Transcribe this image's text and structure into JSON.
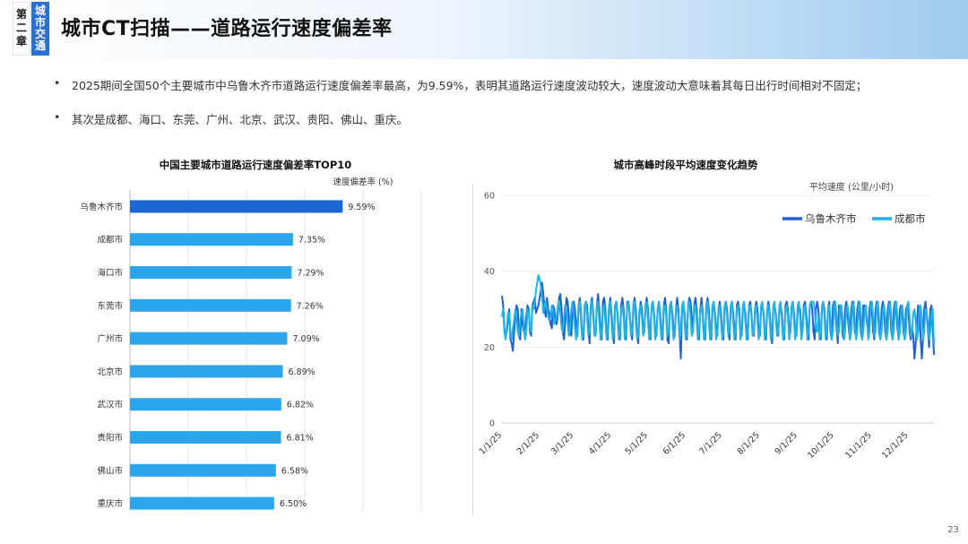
{
  "header": {
    "chapter_part1": "第二章",
    "chapter_part2": "城市交通",
    "title": "城市CT扫描——道路运行速度偏差率"
  },
  "bullets": [
    "2025期间全国50个主要城市中乌鲁木齐市道路运行速度偏差率最高，为9.59%，表明其道路运行速度波动较大，速度波动大意味着其每日出行时间相对不固定；",
    "其次是成都、海口、东莞、广州、北京、武汉、贵阳、佛山、重庆。"
  ],
  "page_number": "23",
  "colors": {
    "accent": "#2a6fd6",
    "bar_top": "#1a66d4",
    "bar": "#2aa6ee",
    "line_urumqi": "#1f5fd1",
    "line_chengdu": "#1fb4e8"
  },
  "chart_data": [
    {
      "type": "bar",
      "orientation": "horizontal",
      "title": "中国主要城市道路运行速度偏差率TOP10",
      "value_label": "速度偏差率 (%)",
      "categories": [
        "乌鲁木齐市",
        "成都市",
        "海口市",
        "东莞市",
        "广州市",
        "北京市",
        "武汉市",
        "贵阳市",
        "佛山市",
        "重庆市"
      ],
      "values": [
        9.59,
        7.35,
        7.29,
        7.26,
        7.09,
        6.89,
        6.82,
        6.81,
        6.58,
        6.5
      ],
      "data_labels": [
        "9.59%",
        "7.35%",
        "7.29%",
        "7.26%",
        "7.09%",
        "6.89%",
        "6.82%",
        "6.81%",
        "6.58%",
        "6.50%"
      ],
      "xlim": [
        0,
        12
      ],
      "grid": true
    },
    {
      "type": "line",
      "title": "城市高峰时段平均速度变化趋势",
      "ylabel": "平均速度 (公里/小时)",
      "ylim": [
        0,
        60
      ],
      "yticks": [
        0,
        20,
        40,
        60
      ],
      "x_ticks": [
        "1/1/25",
        "2/1/25",
        "3/1/25",
        "4/1/25",
        "5/1/25",
        "6/1/25",
        "7/1/25",
        "8/1/25",
        "9/1/25",
        "10/1/25",
        "11/1/25",
        "12/1/25"
      ],
      "legend_position": "top-right",
      "series": [
        {
          "name": "乌鲁木齐市",
          "x_start": "1/1/25",
          "x_end": "12/31/25",
          "step": "1 day",
          "values": [
            33.5,
            31,
            25,
            23,
            24,
            27,
            30,
            22,
            21,
            19,
            24,
            28,
            31,
            30,
            23,
            22,
            30,
            26,
            24,
            25,
            28,
            31,
            30,
            24,
            23,
            31,
            32,
            33,
            29,
            30,
            31,
            33,
            35,
            37,
            34,
            30,
            28,
            33,
            30,
            29,
            26,
            25,
            31,
            30,
            27,
            26,
            29,
            33,
            34,
            30,
            24,
            22,
            27,
            33,
            32,
            28,
            24,
            23,
            30,
            32,
            30,
            26,
            23,
            31,
            33,
            29,
            22,
            22,
            30,
            32,
            31,
            25,
            21,
            31,
            33,
            29,
            24,
            23,
            31,
            34,
            30,
            25,
            22,
            32,
            33,
            30,
            23,
            22,
            30,
            33,
            29,
            24,
            21,
            31,
            32,
            29,
            24,
            22,
            31,
            33,
            30,
            25,
            22,
            32,
            32,
            29,
            24,
            22,
            31,
            33,
            30,
            23,
            21,
            29,
            32,
            30,
            25,
            24,
            31,
            33,
            30,
            24,
            22,
            31,
            32,
            29,
            24,
            23,
            30,
            32,
            29,
            24,
            22,
            31,
            33,
            30,
            22,
            21,
            30,
            32,
            29,
            25,
            23,
            30,
            33,
            30,
            24,
            17,
            30,
            32,
            29,
            24,
            22,
            31,
            33,
            32,
            28,
            24,
            31,
            33,
            30,
            23,
            22,
            30,
            33,
            29,
            24,
            22,
            31,
            33,
            30,
            24,
            22,
            30,
            32,
            29,
            25,
            23,
            30,
            32,
            29,
            24,
            22,
            31,
            32,
            30,
            24,
            22,
            30,
            32,
            29,
            25,
            22,
            31,
            32,
            30,
            24,
            23,
            30,
            31,
            29,
            24,
            22,
            31,
            32,
            29,
            24,
            23,
            30,
            32,
            30,
            24,
            23,
            30,
            31,
            29,
            24,
            22,
            30,
            32,
            29,
            24,
            21,
            30,
            31,
            29,
            25,
            23,
            30,
            31,
            29,
            24,
            22,
            31,
            32,
            30,
            25,
            24,
            30,
            32,
            29,
            24,
            23,
            29,
            31,
            30,
            25,
            24,
            31,
            32,
            29,
            25,
            22,
            31,
            32,
            30,
            24,
            22,
            30,
            32,
            30,
            25,
            22,
            30,
            32,
            30,
            24,
            22,
            30,
            32,
            24,
            22,
            31,
            32,
            30,
            25,
            21,
            31,
            31,
            30,
            23,
            22,
            30,
            32,
            29,
            25,
            22,
            30,
            32,
            30,
            24,
            23,
            30,
            32,
            29,
            24,
            22,
            31,
            31,
            30,
            26,
            24,
            30,
            32,
            30,
            24,
            22,
            30,
            32,
            30,
            24,
            22,
            30,
            32,
            30,
            24,
            22,
            30,
            32,
            30,
            24,
            22,
            30,
            32,
            30,
            25,
            22,
            30,
            31,
            29,
            24,
            22,
            30,
            31,
            30,
            24,
            22,
            25,
            23,
            17,
            21,
            26,
            31,
            30,
            23,
            17,
            22,
            30,
            32,
            29,
            25,
            20,
            30,
            31,
            25,
            18
          ],
          "note_values": "approx. read from line"
        },
        {
          "name": "成都市",
          "x_start": "1/1/25",
          "x_end": "12/31/25",
          "step": "1 day",
          "values": [
            28,
            30,
            24,
            22,
            25,
            29,
            29,
            24,
            22,
            25,
            27,
            30,
            28,
            24,
            23,
            27,
            29,
            30,
            25,
            22,
            24,
            30,
            29,
            25,
            24,
            31,
            30,
            32,
            35,
            37,
            39,
            38,
            36,
            33,
            29,
            31,
            32,
            30,
            28,
            27,
            28,
            31,
            30,
            26,
            27,
            28,
            31,
            32,
            29,
            25,
            24,
            28,
            31,
            30,
            26,
            23,
            25,
            30,
            32,
            29,
            25,
            22,
            25,
            31,
            32,
            27,
            22,
            24,
            31,
            32,
            28,
            23,
            24,
            31,
            32,
            28,
            23,
            23,
            31,
            32,
            27,
            22,
            24,
            30,
            31,
            27,
            22,
            24,
            31,
            32,
            27,
            22,
            24,
            31,
            32,
            28,
            22,
            24,
            30,
            31,
            28,
            22,
            24,
            31,
            32,
            28,
            23,
            24,
            31,
            32,
            27,
            22,
            23,
            30,
            31,
            28,
            23,
            24,
            31,
            32,
            27,
            22,
            24,
            31,
            32,
            28,
            22,
            24,
            30,
            32,
            27,
            22,
            24,
            31,
            31,
            28,
            23,
            24,
            31,
            32,
            27,
            22,
            23,
            30,
            31,
            28,
            22,
            24,
            31,
            32,
            27,
            22,
            24,
            31,
            32,
            28,
            23,
            24,
            31,
            31,
            27,
            22,
            24,
            30,
            31,
            28,
            22,
            24,
            31,
            32,
            27,
            22,
            24,
            31,
            32,
            28,
            22,
            24,
            30,
            31,
            27,
            22,
            24,
            31,
            32,
            28,
            23,
            24,
            31,
            32,
            27,
            22,
            24,
            30,
            31,
            28,
            22,
            24,
            31,
            32,
            27,
            22,
            24,
            31,
            31,
            28,
            23,
            24,
            30,
            31,
            27,
            22,
            24,
            31,
            32,
            28,
            22,
            24,
            30,
            31,
            27,
            22,
            24,
            31,
            32,
            28,
            23,
            24,
            31,
            32,
            27,
            22,
            24,
            30,
            31,
            28,
            22,
            24,
            31,
            32,
            27,
            22,
            24,
            31,
            32,
            28,
            22,
            24,
            30,
            31,
            27,
            22,
            24,
            31,
            32,
            32,
            32,
            30,
            25,
            24,
            28,
            22,
            24,
            31,
            32,
            28,
            22,
            24,
            30,
            31,
            27,
            22,
            24,
            31,
            32,
            28,
            23,
            24,
            31,
            31,
            27,
            22,
            24,
            30,
            31,
            28,
            22,
            24,
            31,
            32,
            27,
            22,
            24,
            31,
            32,
            28,
            22,
            24,
            30,
            31,
            27,
            22,
            24,
            31,
            32,
            28,
            23,
            24,
            31,
            32,
            27,
            22,
            24,
            30,
            31,
            28,
            22,
            24,
            31,
            32,
            27,
            22,
            24,
            31,
            32,
            28,
            22,
            24,
            30,
            31,
            27,
            22,
            24,
            31,
            32,
            28,
            23,
            24,
            29,
            30,
            27,
            22,
            24,
            30,
            31,
            28,
            22,
            24,
            30,
            29,
            27,
            22,
            24,
            29,
            30,
            21
          ],
          "note_values": "approx. read from line"
        }
      ]
    }
  ]
}
